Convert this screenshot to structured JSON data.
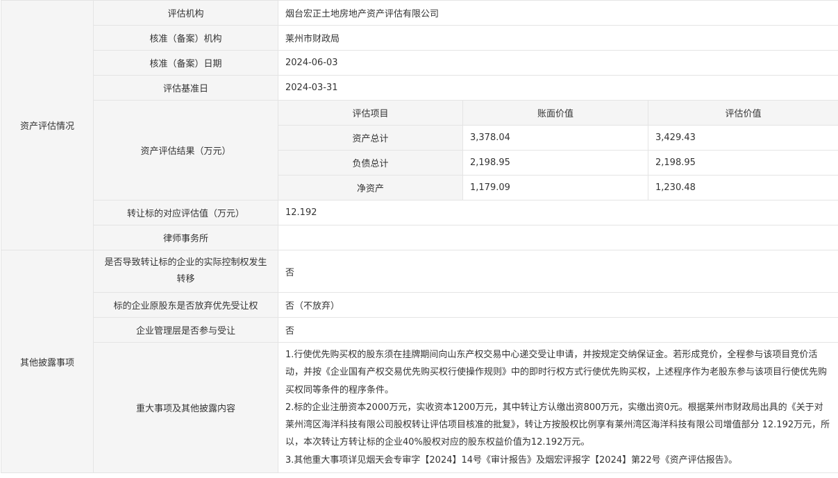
{
  "sections": {
    "asset_evaluation": "资产评估情况",
    "other_disclosure": "其他披露事项"
  },
  "evaluation": {
    "agency_label": "评估机构",
    "agency_value": "烟台宏正土地房地产资产评估有限公司",
    "approval_agency_label": "核准（备案）机构",
    "approval_agency_value": "莱州市财政局",
    "approval_date_label": "核准（备案）日期",
    "approval_date_value": "2024-06-03",
    "base_date_label": "评估基准日",
    "base_date_value": "2024-03-31",
    "result_label": "资产评估结果（万元）",
    "result_table": {
      "headers": [
        "评估项目",
        "账面价值",
        "评估价值"
      ],
      "rows": [
        {
          "item": "资产总计",
          "book": "3,378.04",
          "appraised": "3,429.43"
        },
        {
          "item": "负债总计",
          "book": "2,198.95",
          "appraised": "2,198.95"
        },
        {
          "item": "净资产",
          "book": "1,179.09",
          "appraised": "1,230.48"
        }
      ]
    },
    "target_value_label": "转让标的对应评估值（万元）",
    "target_value": "12.192",
    "law_firm_label": "律师事务所",
    "law_firm_value": ""
  },
  "other": {
    "control_change_label": "是否导致转让标的企业的实际控制权发生转移",
    "control_change_value": "否",
    "preemptive_label": "标的企业原股东是否放弃优先受让权",
    "preemptive_value": "否（不放弃）",
    "management_label": "企业管理层是否参与受让",
    "management_value": "否",
    "major_items_label": "重大事项及其他披露内容",
    "major_items_lines": [
      "1.行使优先购买权的股东须在挂牌期间向山东产权交易中心递交受让申请，并按规定交纳保证金。若形成竞价，全程参与该项目竞价活动，并按《企业国有产权交易优先购买权行使操作规则》中的即时行权方式行使优先购买权，上述程序作为老股东参与该项目行使优先购买权同等条件的程序条件。",
      "2.标的企业注册资本2000万元，实收资本1200万元，其中转让方认缴出资800万元，实缴出资0元。根据莱州市财政局出具的《关于对莱州湾区海洋科技有限公司股权转让评估项目核准的批复》，转让方按股权比例享有莱州湾区海洋科技有限公司增值部分 12.192万元，所以，本次转让方转让标的企业40%股权对应的股东权益价值为12.192万元。",
      "3.其他重大事项详见烟天会专审字【2024】14号《审计报告》及烟宏评报字【2024】第22号《资产评估报告》。"
    ]
  }
}
